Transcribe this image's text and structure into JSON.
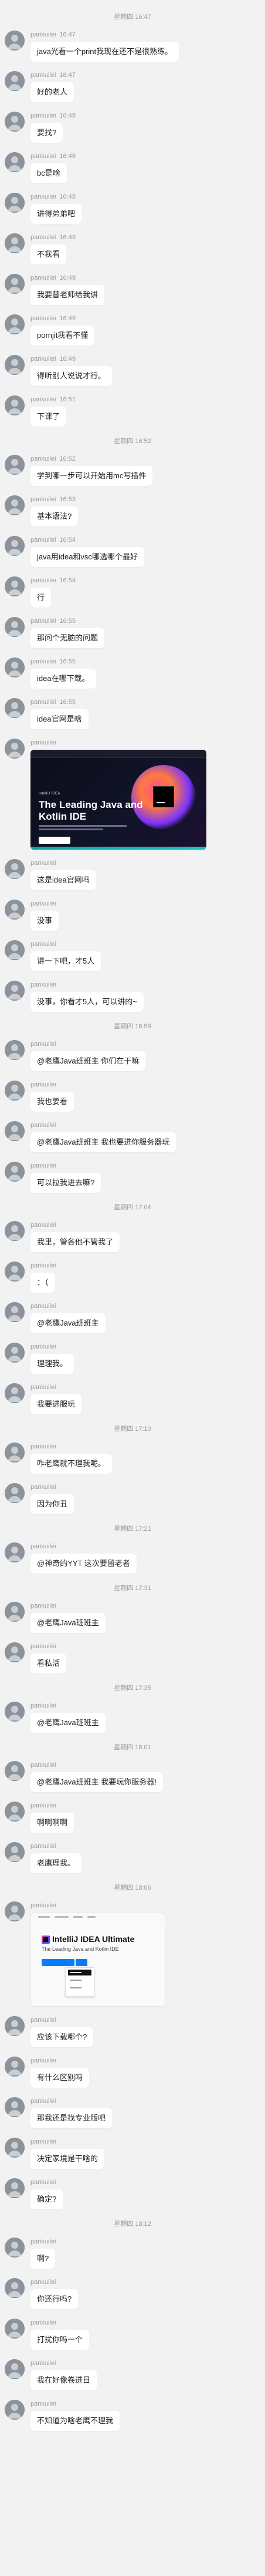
{
  "sender": "pankuilei",
  "items": [
    {
      "type": "time",
      "text": "星期四 16:47"
    },
    {
      "type": "msg",
      "time": "16:47",
      "text": "java光看一个print我现在还不是很熟练。"
    },
    {
      "type": "msg",
      "time": "16:47",
      "text": "好的老人"
    },
    {
      "type": "msg",
      "time": "16:48",
      "text": "要找?"
    },
    {
      "type": "msg",
      "time": "16:48",
      "text": "bc是啥"
    },
    {
      "type": "msg",
      "time": "16:48",
      "text": "讲得弟弟吧"
    },
    {
      "type": "msg",
      "time": "16:49",
      "text": "不我看"
    },
    {
      "type": "msg",
      "time": "16:49",
      "text": "我要替老师给我讲"
    },
    {
      "type": "msg",
      "time": "16:49",
      "text": "pornjit我看不懂"
    },
    {
      "type": "msg",
      "time": "16:49",
      "text": "得听别人说说才行。"
    },
    {
      "type": "msg",
      "time": "16:51",
      "text": "下课了"
    },
    {
      "type": "time",
      "text": "星期四 16:52"
    },
    {
      "type": "msg",
      "time": "16:52",
      "text": "学到哪一步可以开始用mc写插件"
    },
    {
      "type": "msg",
      "time": "16:53",
      "text": "基本语法?"
    },
    {
      "type": "msg",
      "time": "16:54",
      "text": "java用idea和vsc哪选哪个最好"
    },
    {
      "type": "msg",
      "time": "16:54",
      "text": "行"
    },
    {
      "type": "msg",
      "time": "16:55",
      "text": "那问个无脑的问题"
    },
    {
      "type": "msg",
      "time": "16:55",
      "text": "idea在哪下载。"
    },
    {
      "type": "msg",
      "time": "16:55",
      "text": "idea官网是啥"
    },
    {
      "type": "image",
      "time": "",
      "headline": "The Leading Java and Kotlin IDE",
      "small_label": "IntelliJ IDEA"
    },
    {
      "type": "msg",
      "time": "",
      "text": "这是idea官网吗"
    },
    {
      "type": "msg",
      "time": "",
      "text": "没事"
    },
    {
      "type": "msg",
      "time": "",
      "text": "讲一下吧，才5人"
    },
    {
      "type": "msg",
      "time": "",
      "text": "没事，你看才5人，可以讲的~"
    },
    {
      "type": "time",
      "text": "星期四 16:59"
    },
    {
      "type": "msg",
      "time": "",
      "text": "@老鹰Java班班主 你们在干嘛"
    },
    {
      "type": "msg",
      "time": "",
      "text": "我也要看"
    },
    {
      "type": "msg",
      "time": "",
      "text": "@老鹰Java班班主 我也要进你服务器玩"
    },
    {
      "type": "msg",
      "time": "",
      "text": "可以拉我进去嘛?"
    },
    {
      "type": "time",
      "text": "星期四 17:04"
    },
    {
      "type": "msg",
      "time": "",
      "text": "我里，管各他不管我了"
    },
    {
      "type": "msg",
      "time": "",
      "text": "：（"
    },
    {
      "type": "msg",
      "time": "",
      "text": "@老鹰Java班班主"
    },
    {
      "type": "msg",
      "time": "",
      "text": "理理我。"
    },
    {
      "type": "msg",
      "time": "",
      "text": "我要进服玩"
    },
    {
      "type": "time",
      "text": "星期四 17:10"
    },
    {
      "type": "msg",
      "time": "",
      "text": "咋老鹰就不理我呢。"
    },
    {
      "type": "msg",
      "time": "",
      "text": "因为你丑"
    },
    {
      "type": "time",
      "text": "星期四 17:21"
    },
    {
      "type": "msg",
      "time": "",
      "text": "@神奇的YYT 这次要留老者"
    },
    {
      "type": "time",
      "text": "星期四 17:31"
    },
    {
      "type": "msg",
      "time": "",
      "text": "@老鹰Java班班主"
    },
    {
      "type": "msg",
      "time": "",
      "text": "看私活"
    },
    {
      "type": "time",
      "text": "星期四 17:35"
    },
    {
      "type": "msg",
      "time": "",
      "text": "@老鹰Java班班主"
    },
    {
      "type": "time",
      "text": "星期四 18:01"
    },
    {
      "type": "msg",
      "time": "",
      "text": "@老鹰Java班班主 我要玩你服务器!"
    },
    {
      "type": "msg",
      "time": "",
      "text": "啊啊啊啊"
    },
    {
      "type": "msg",
      "time": "",
      "text": "老鹰理我。"
    },
    {
      "type": "time",
      "text": "星期四 18:06"
    },
    {
      "type": "image2",
      "time": "",
      "title": "IntelliJ IDEA Ultimate",
      "subtitle": "The Leading Java and Kotlin IDE"
    },
    {
      "type": "msg",
      "time": "",
      "text": "应该下载哪个?"
    },
    {
      "type": "msg",
      "time": "",
      "text": "有什么区别吗"
    },
    {
      "type": "msg",
      "time": "",
      "text": "那我还是找专业版吧"
    },
    {
      "type": "msg",
      "time": "",
      "text": "决定家境是干啥的"
    },
    {
      "type": "msg",
      "time": "",
      "text": "确定?"
    },
    {
      "type": "time",
      "text": "星期四 18:12"
    },
    {
      "type": "msg",
      "time": "",
      "text": "啊?"
    },
    {
      "type": "msg",
      "time": "",
      "text": "你还行吗?"
    },
    {
      "type": "msg",
      "time": "",
      "text": "打扰你吗一个"
    },
    {
      "type": "msg",
      "time": "",
      "text": "我在好像卷进日"
    },
    {
      "type": "msg",
      "time": "",
      "text": "不知道为啥老鹰不理我"
    }
  ]
}
